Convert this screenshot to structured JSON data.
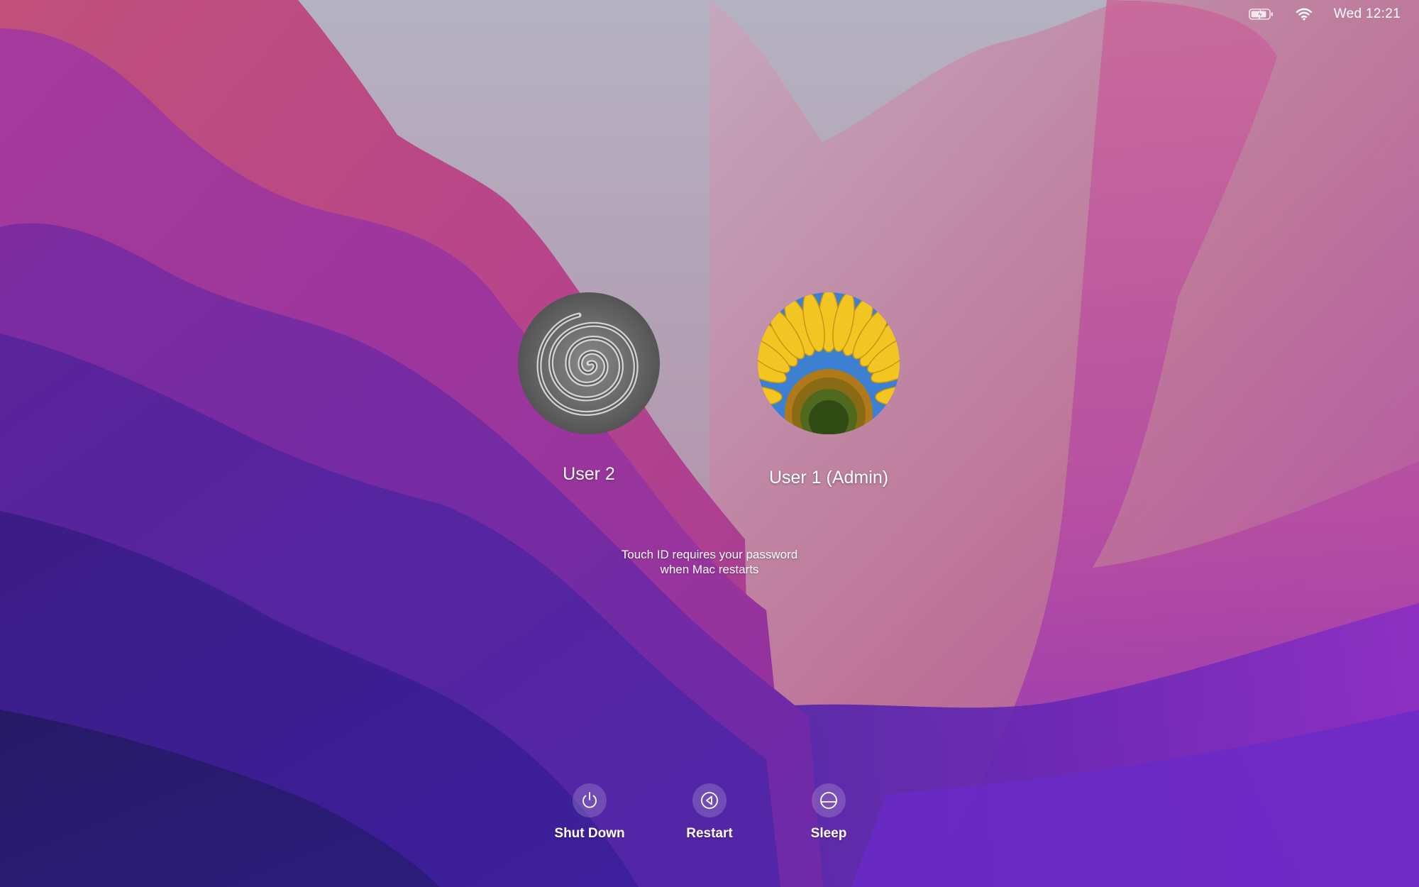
{
  "menubar": {
    "battery_icon": "battery-charging-icon",
    "wifi_icon": "wifi-icon",
    "clock": "Wed 12:21"
  },
  "users": [
    {
      "name": "User 2",
      "avatar": "zen-sand-spiral"
    },
    {
      "name": "User  1 (Admin)",
      "avatar": "sunflower"
    }
  ],
  "touch_id_note": {
    "line1": "Touch ID requires your password",
    "line2": "when Mac restarts"
  },
  "actions": {
    "shutdown": {
      "label": "Shut Down",
      "icon": "power-icon"
    },
    "restart": {
      "label": "Restart",
      "icon": "restart-icon"
    },
    "sleep": {
      "label": "Sleep",
      "icon": "sleep-icon"
    }
  },
  "colors": {
    "wallpaper_grey": "#b2aebd",
    "wallpaper_pink": "#c4577e",
    "wallpaper_purple": "#7a2fa6",
    "wallpaper_deep": "#2a1a6e",
    "text": "#ffffff"
  }
}
